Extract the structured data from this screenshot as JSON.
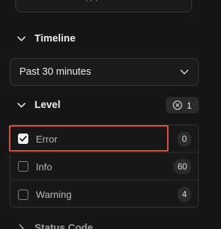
{
  "top_input": {
    "value": "( ) )"
  },
  "timeline": {
    "title": "Timeline",
    "expanded": true,
    "selected": "Past 30 minutes"
  },
  "level": {
    "title": "Level",
    "expanded": true,
    "active_filter_count": "1",
    "options": [
      {
        "label": "Error",
        "count": "0",
        "checked": true
      },
      {
        "label": "Info",
        "count": "60",
        "checked": false
      },
      {
        "label": "Warning",
        "count": "4",
        "checked": false
      }
    ]
  },
  "status_code": {
    "title": "Status Code",
    "expanded": false
  },
  "colors": {
    "background": "#161616",
    "border": "#3a3a3a",
    "highlight": "#e5533e",
    "checked": "#f2f2f2"
  }
}
